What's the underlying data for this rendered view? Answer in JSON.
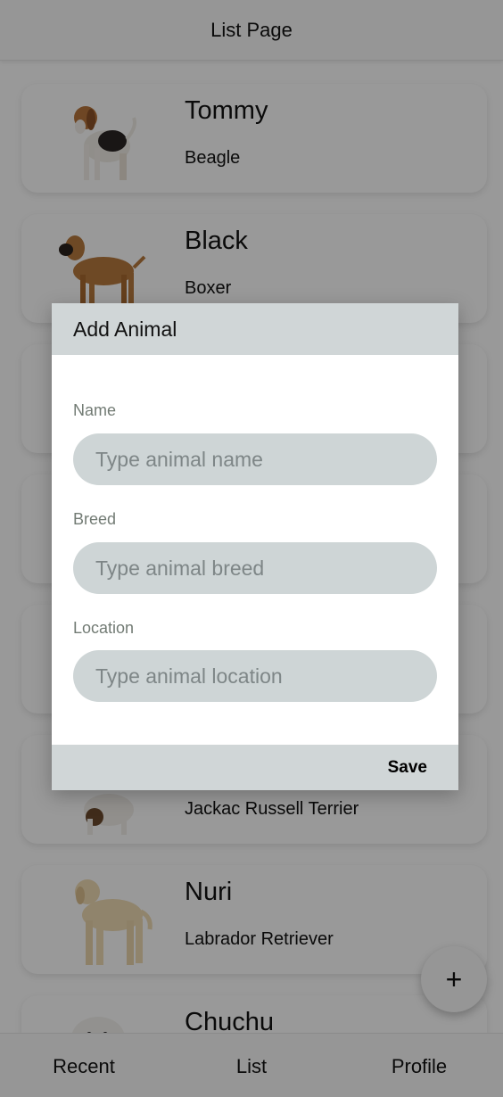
{
  "header": {
    "title": "List Page"
  },
  "animals": [
    {
      "name": "Tommy",
      "breed": "Beagle",
      "image_icon": "beagle-dog-icon"
    },
    {
      "name": "Black",
      "breed": "Boxer",
      "image_icon": "boxer-dog-icon"
    },
    {
      "name": "",
      "breed": "",
      "image_icon": "dog-icon"
    },
    {
      "name": "",
      "breed": "",
      "image_icon": "doberman-dog-icon"
    },
    {
      "name": "",
      "breed": "",
      "image_icon": "dog-icon"
    },
    {
      "name": "",
      "breed": "Jackac Russell Terrier",
      "image_icon": "terrier-dog-icon"
    },
    {
      "name": "Nuri",
      "breed": "Labrador Retriever",
      "image_icon": "labrador-dog-icon"
    },
    {
      "name": "Chuchu",
      "breed": "",
      "image_icon": "maltese-dog-icon"
    }
  ],
  "fab": {
    "label": "+"
  },
  "bottom_nav": {
    "recent": "Recent",
    "list": "List",
    "profile": "Profile"
  },
  "dialog": {
    "title": "Add Animal",
    "name_label": "Name",
    "name_placeholder": "Type animal name",
    "breed_label": "Breed",
    "breed_placeholder": "Type animal breed",
    "location_label": "Location",
    "location_placeholder": "Type animal location",
    "save_label": "Save"
  },
  "colors": {
    "dialog_bar": "#d0d6d7",
    "input_bg": "#ced5d6",
    "label_text": "#727b74",
    "overlay": "rgba(0,0,0,0.40)"
  }
}
